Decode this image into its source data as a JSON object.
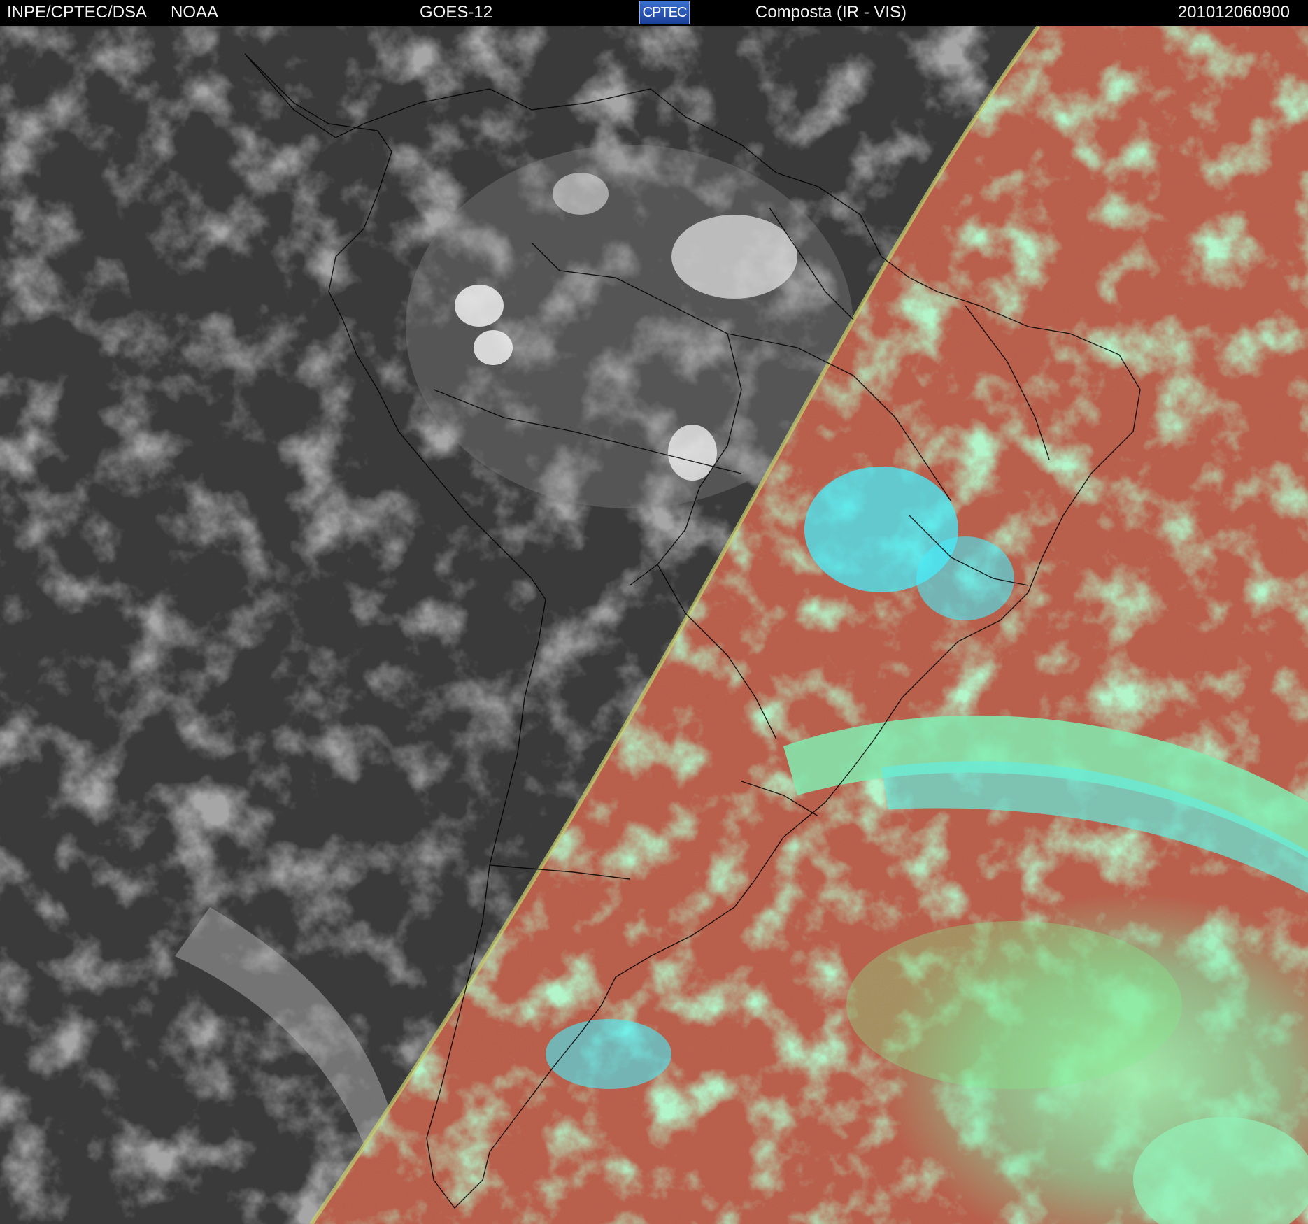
{
  "header": {
    "organization": "INPE/CPTEC/DSA",
    "agency": "NOAA",
    "satellite": "GOES-12",
    "logo_text": "CPTEC",
    "product": "Composta (IR - VIS)",
    "timestamp": "201012060900"
  },
  "colors": {
    "header_bg": "#000000",
    "header_text": "#f2f2f2",
    "night_gray": "#3a3a3a",
    "day_red": "#b85a45",
    "day_cloud_green": "#7ef08a",
    "day_cloud_cyan": "#3ff0ff",
    "border_lines": "#000000"
  },
  "icons": {
    "logo": "cptec-logo"
  }
}
